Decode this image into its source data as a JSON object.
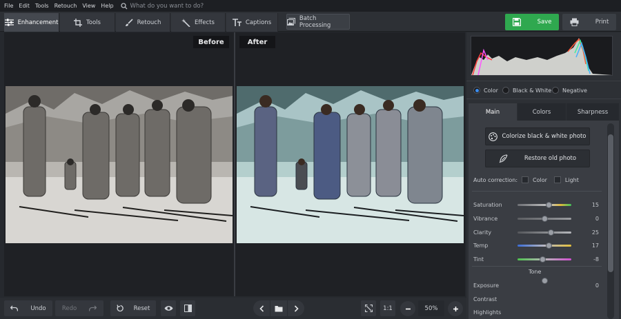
{
  "menu": [
    "File",
    "Edit",
    "Tools",
    "Retouch",
    "View",
    "Help"
  ],
  "search": {
    "placeholder": "What do you want to do?"
  },
  "tabs": [
    {
      "label": "Enhancement",
      "icon": "sliders-icon"
    },
    {
      "label": "Tools",
      "icon": "crop-icon"
    },
    {
      "label": "Retouch",
      "icon": "brush-icon"
    },
    {
      "label": "Effects",
      "icon": "magic-wand-icon"
    },
    {
      "label": "Captions",
      "icon": "text-icon"
    }
  ],
  "batch": {
    "label": "Batch Processing",
    "icon": "image-stack-icon"
  },
  "save": {
    "label": "Save",
    "icon": "floppy-icon",
    "color": "#2fa84f"
  },
  "print": {
    "label": "Print",
    "icon": "printer-icon"
  },
  "view": {
    "before": "Before",
    "after": "After"
  },
  "modes": {
    "selected": "Color",
    "options": [
      "Color",
      "Black & White",
      "Negative"
    ]
  },
  "panel_tabs": {
    "active": "Main",
    "items": [
      "Main",
      "Colors",
      "Sharpness"
    ]
  },
  "actions": {
    "colorize": "Colorize black & white photo",
    "restore": "Restore old photo"
  },
  "auto_correction": {
    "label": "Auto correction:",
    "color": "Color",
    "light": "Light"
  },
  "sliders": [
    {
      "label": "Saturation",
      "value": "15",
      "level": 0.58
    },
    {
      "label": "Vibrance",
      "value": "0",
      "level": 0.5
    },
    {
      "label": "Clarity",
      "value": "25",
      "level": 0.62
    },
    {
      "label": "Temp",
      "value": "17",
      "level": 0.58
    },
    {
      "label": "Tint",
      "value": "-8",
      "level": 0.46
    }
  ],
  "tone": {
    "title": "Tone",
    "items": [
      {
        "label": "Exposure",
        "value": "0"
      },
      {
        "label": "Contrast",
        "value": ""
      },
      {
        "label": "Highlights",
        "value": ""
      }
    ]
  },
  "bottom": {
    "undo": "Undo",
    "redo": "Redo",
    "reset": "Reset",
    "ratio": "1:1",
    "zoom": "50%"
  }
}
